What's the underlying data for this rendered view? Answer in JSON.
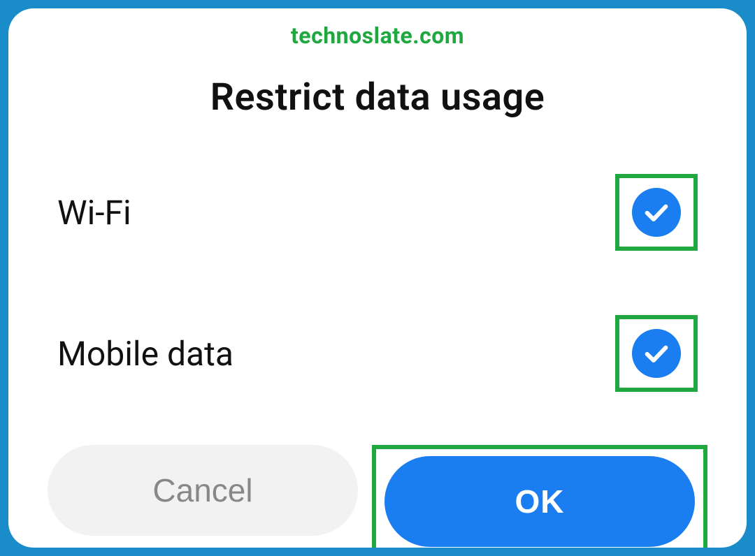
{
  "watermark": "technoslate.com",
  "dialog": {
    "title": "Restrict data usage",
    "options": [
      {
        "label": "Wi-Fi",
        "checked": true
      },
      {
        "label": "Mobile data",
        "checked": true
      }
    ],
    "buttons": {
      "cancel": "Cancel",
      "ok": "OK"
    }
  }
}
